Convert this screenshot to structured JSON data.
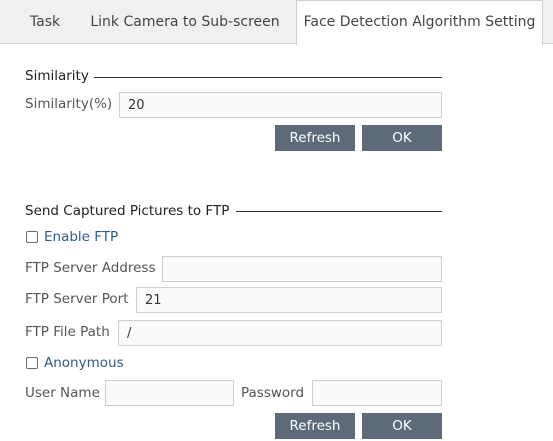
{
  "tabs": [
    {
      "label": "Task"
    },
    {
      "label": "Link Camera to Sub-screen"
    },
    {
      "label": "Face Detection Algorithm Setting"
    }
  ],
  "similarity": {
    "section_title": "Similarity",
    "field_label": "Similarity(%)",
    "value": "20",
    "refresh_label": "Refresh",
    "ok_label": "OK"
  },
  "ftp": {
    "section_title": "Send Captured Pictures to FTP",
    "enable_label": "Enable FTP",
    "enable_checked": false,
    "server_address_label": "FTP Server Address",
    "server_address_value": "",
    "server_port_label": "FTP Server Port",
    "server_port_value": "21",
    "file_path_label": "FTP File Path",
    "file_path_value": "/",
    "anonymous_label": "Anonymous",
    "anonymous_checked": false,
    "username_label": "User Name",
    "username_value": "",
    "password_label": "Password",
    "password_value": "",
    "refresh_label": "Refresh",
    "ok_label": "OK"
  },
  "colors": {
    "button": "#5c6a7a",
    "checkbox_label": "#2f5a86",
    "tabbar": "#f0f0f0"
  }
}
